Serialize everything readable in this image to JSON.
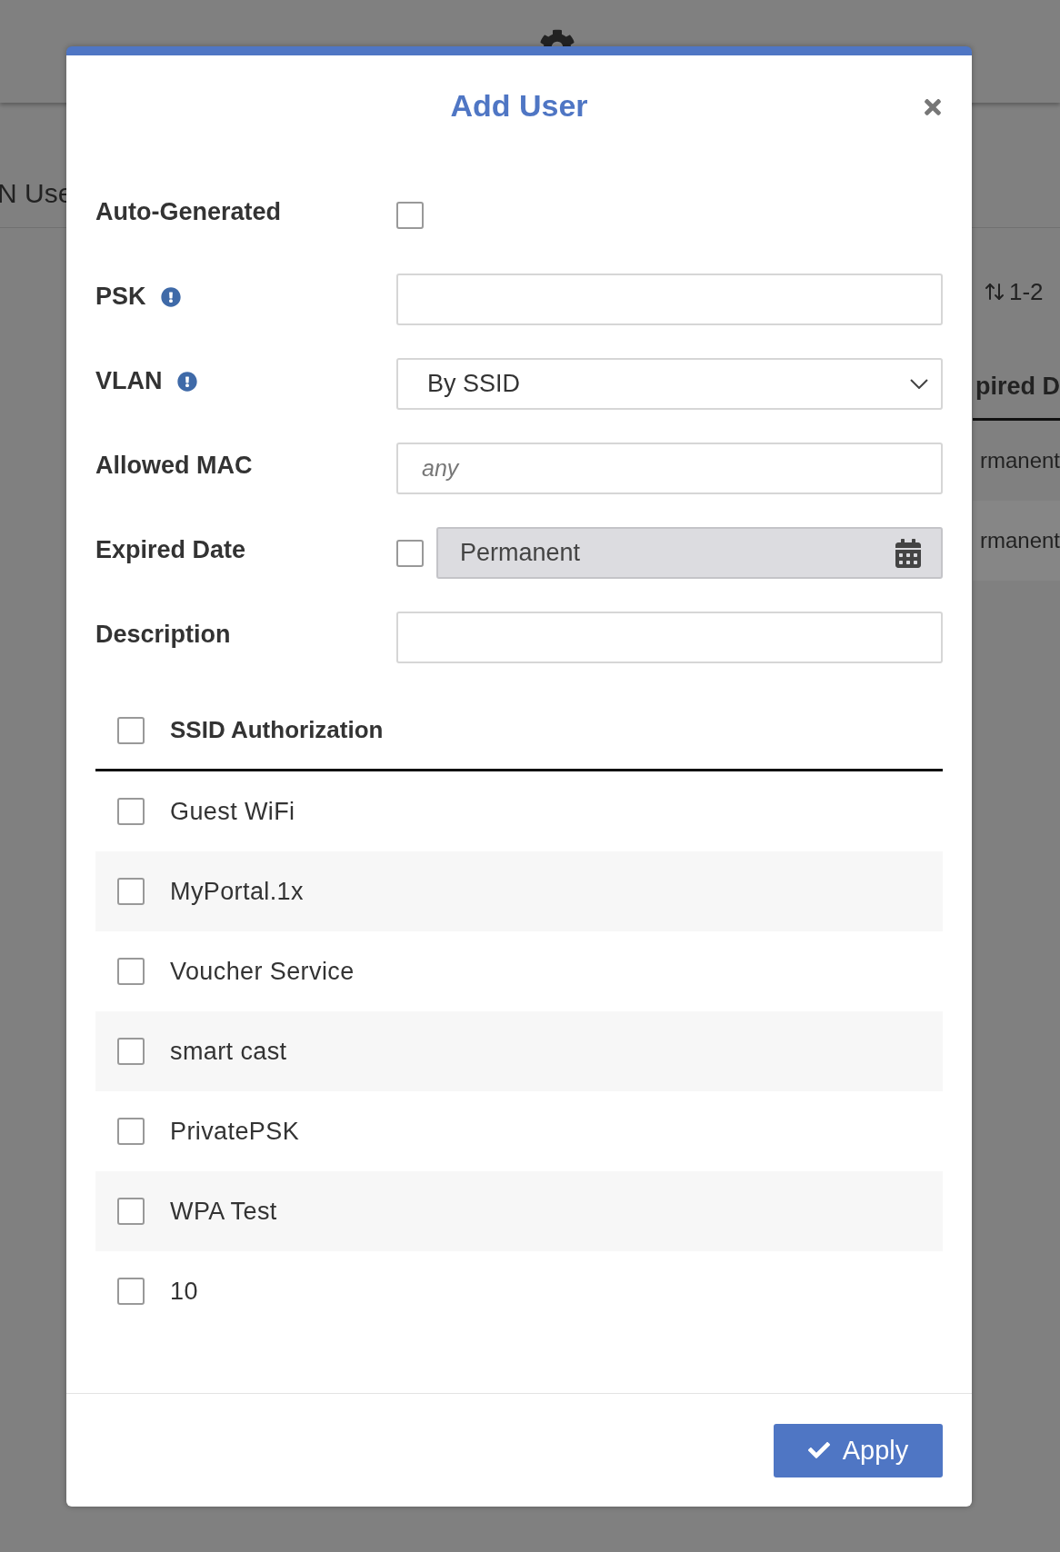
{
  "background": {
    "section_label": "N Use",
    "pagination": "1-2",
    "column_header": "pired D",
    "rows": [
      "rmanent",
      "rmanent"
    ]
  },
  "dialog": {
    "title": "Add User",
    "fields": [
      {
        "kind": "checkbox",
        "label": "Auto-Generated",
        "checked": false
      },
      {
        "kind": "text",
        "label": "PSK",
        "info": true
      },
      {
        "kind": "select",
        "label": "VLAN",
        "info": true,
        "value": "By SSID"
      },
      {
        "kind": "text",
        "label": "Allowed MAC",
        "placeholder": "any"
      },
      {
        "kind": "date",
        "label": "Expired Date",
        "checked": false,
        "disabled": true,
        "value": "Permanent"
      },
      {
        "kind": "text",
        "label": "Description"
      }
    ],
    "ssid": {
      "header": {
        "label": "SSID Authorization",
        "checked": false
      },
      "items": [
        {
          "label": "Guest WiFi",
          "checked": false
        },
        {
          "label": "MyPortal.1x",
          "checked": false
        },
        {
          "label": "Voucher Service",
          "checked": false
        },
        {
          "label": "smart cast",
          "checked": false
        },
        {
          "label": "PrivatePSK",
          "checked": false
        },
        {
          "label": "WPA Test",
          "checked": false
        },
        {
          "label": "10",
          "checked": false
        }
      ]
    },
    "button": "Apply"
  }
}
